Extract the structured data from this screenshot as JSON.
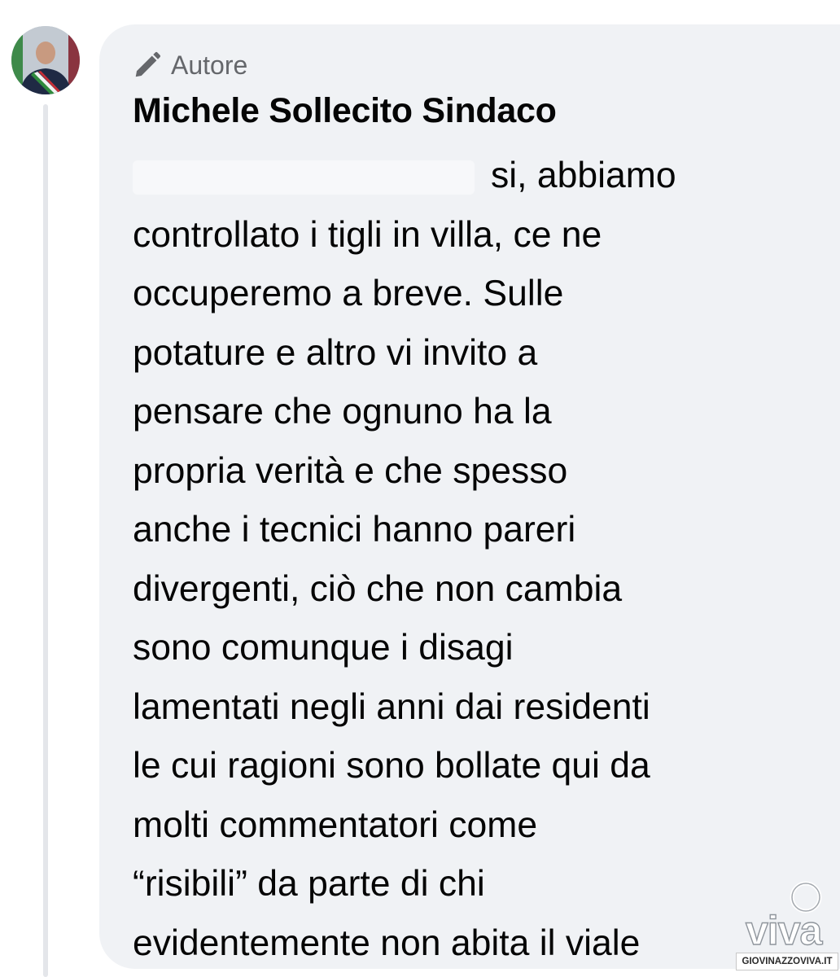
{
  "comment": {
    "badge": {
      "icon": "pencil-icon",
      "label": "Autore"
    },
    "author": {
      "name": "Michele Sollecito Sindaco",
      "avatar": "avatar-photo"
    },
    "mention": "",
    "lines": [
      "si, abbiamo",
      "controllato i tigli in villa, ce ne",
      "occuperemo a breve. Sulle",
      "potature e altro vi invito a",
      "pensare che ognuno ha la",
      "propria verità e che spesso",
      "anche i tecnici hanno pareri",
      "divergenti, ciò che non cambia",
      "sono comunque i disagi",
      "lamentati negli anni dai residenti",
      "le cui ragioni sono bollate qui da",
      "molti commentatori come",
      "“risibili” da parte di chi",
      "evidentemente non abita il viale"
    ]
  },
  "watermark": {
    "logo_text": "viva",
    "source": "GIOVINAZZOVIVA.IT"
  },
  "colors": {
    "bubble": "#f0f2f5",
    "thread_line": "#e4e6ea",
    "badge_text": "#65676b",
    "text": "#050505"
  }
}
